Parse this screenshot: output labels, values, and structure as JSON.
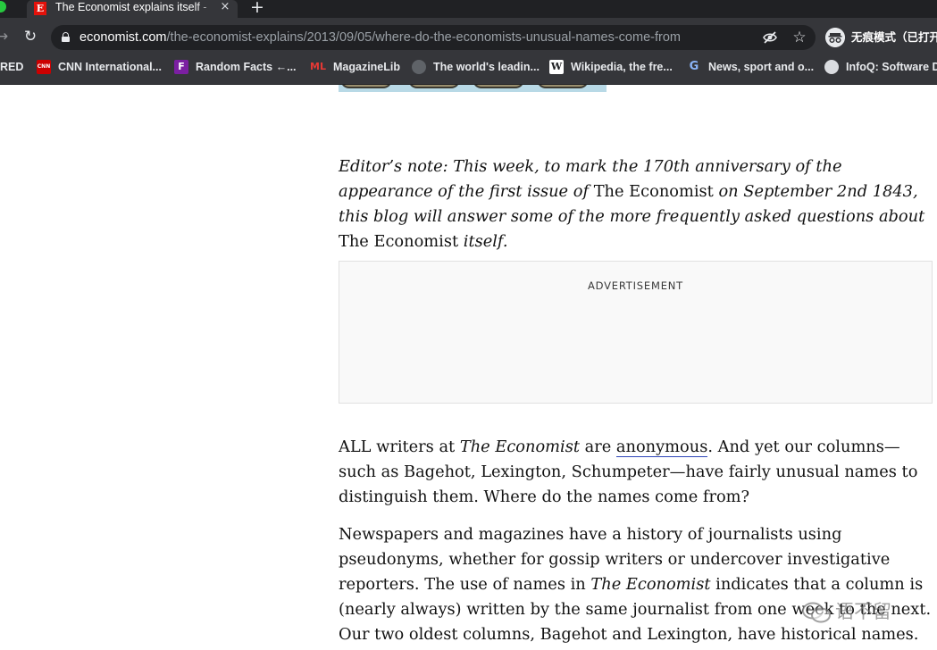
{
  "browser": {
    "tab": {
      "favicon_letter": "E",
      "title": "The Economist explains itself - ",
      "close_glyph": "×"
    },
    "new_tab_glyph": "+",
    "toolbar": {
      "back_glyph": "→",
      "reload_glyph": "↻",
      "url_domain": "economist.com",
      "url_path": "/the-economist-explains/2013/09/05/where-do-the-economists-unusual-names-come-from",
      "star_glyph": "☆",
      "incognito_label": "无痕模式（已打开"
    },
    "bookmarks": [
      {
        "label": "RED",
        "icon": "none"
      },
      {
        "label": "CNN International...",
        "icon": "cnn-icon",
        "icon_text": "CNN"
      },
      {
        "label": "Random Facts ←...",
        "icon": "f-icon",
        "icon_text": "F"
      },
      {
        "label": "MagazineLib",
        "icon": "ml-icon",
        "icon_text": "ML"
      },
      {
        "label": "The world's leadin...",
        "icon": "github-icon"
      },
      {
        "label": "Wikipedia, the fre...",
        "icon": "wikipedia-icon",
        "icon_text": "W"
      },
      {
        "label": "News, sport and o...",
        "icon": "g-icon",
        "icon_text": "G"
      },
      {
        "label": "InfoQ: Software D...",
        "icon": "globe-icon"
      }
    ]
  },
  "article": {
    "editors_note": {
      "part1": "Editor’s note: This week, to mark the 170th anniversary of the appearance of the first issue of ",
      "pub1": "The Economist",
      "part2": " on September 2nd 1843, this blog will answer some of the more frequently asked questions about ",
      "pub2": "The Economist",
      "part3": " itself."
    },
    "advertisement_label": "ADVERTISEMENT",
    "paragraph1": {
      "t1": "ALL writers at ",
      "pub": "The Economist",
      "t2": " are ",
      "link": "anonymous",
      "t3": ". And yet our columns—such as Bagehot, Lexington, Schumpeter—have fairly unusual names to distinguish them. Where do the names come from?"
    },
    "paragraph2": {
      "t1": "Newspapers and magazines have a history of journalists using pseudonyms, whether for gossip writers or undercover investigative reporters. The use of names in ",
      "pub": "The Economist",
      "t2": " indicates that a column is (nearly always) written by the same journalist from one week to the next. Our two oldest columns, Bagehot and Lexington, have historical names. Bagehot, a column about"
    }
  },
  "watermark": {
    "text": "语不留"
  },
  "colors": {
    "chrome_dark": "#202124",
    "chrome_toolbar": "#35363a",
    "economist_red": "#e3120b",
    "link_underline": "#2e45b8"
  }
}
